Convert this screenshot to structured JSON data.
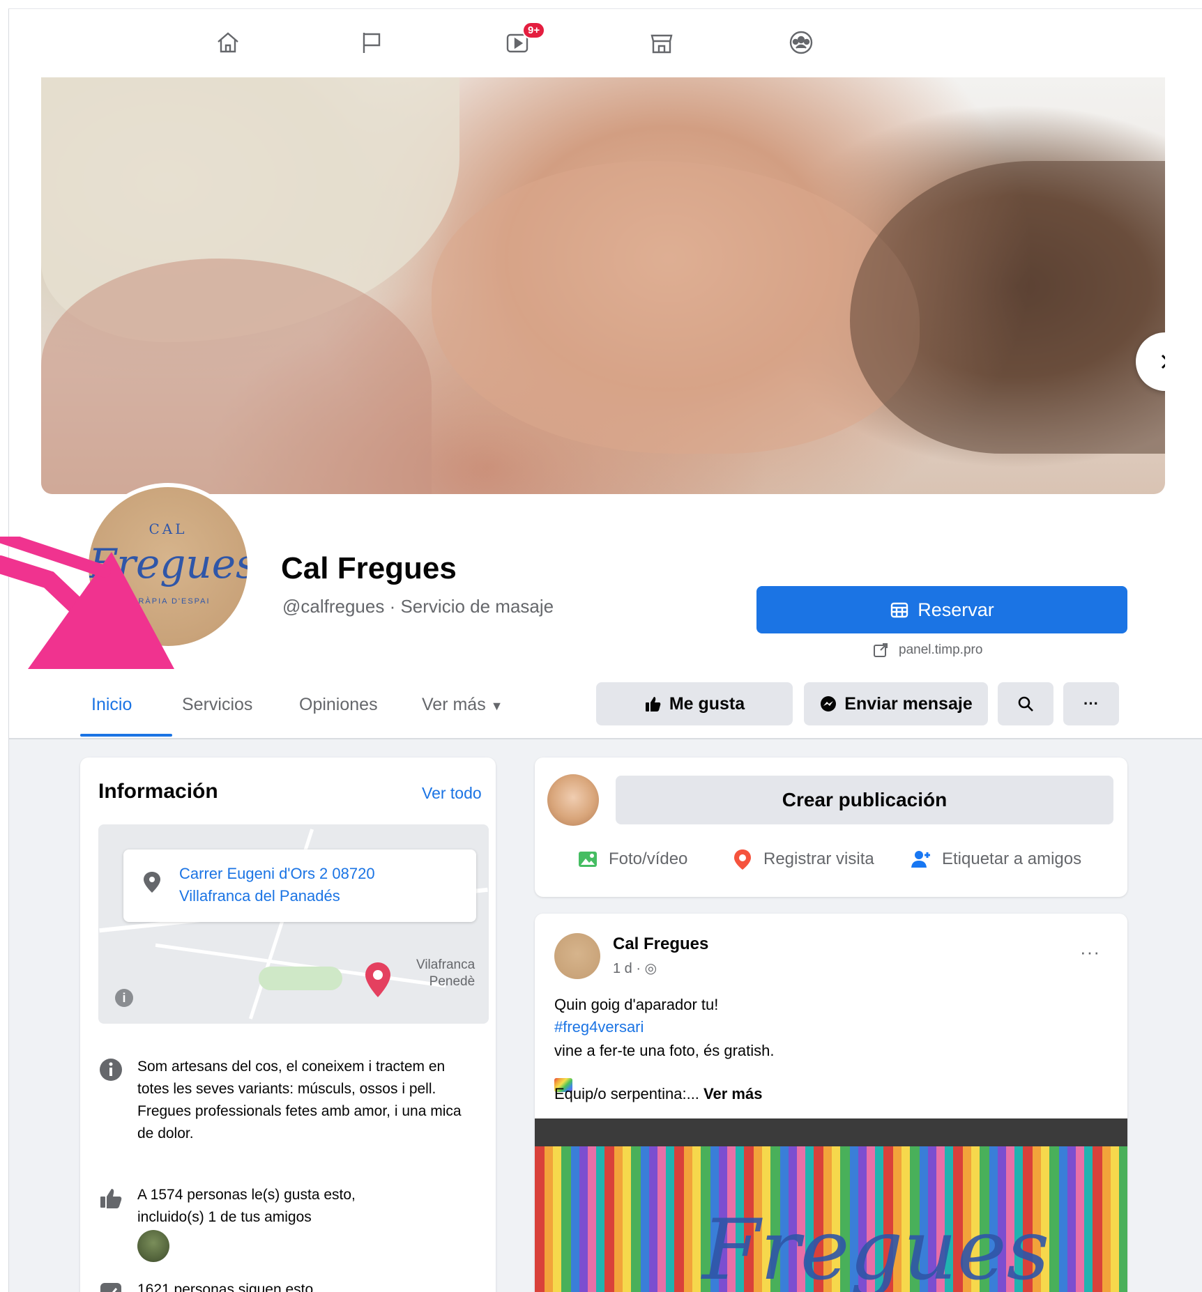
{
  "topnav": {
    "video_badge": "9+",
    "icons": [
      "home-icon",
      "flag-icon",
      "watch-icon",
      "marketplace-icon",
      "groups-icon"
    ]
  },
  "cover": {
    "next_icon": "chevron-right-icon"
  },
  "profile": {
    "logo_top": "CAL",
    "logo_main": "Fregues",
    "logo_sub": "TERÀPIA D'ESPAI",
    "name": "Cal Fregues",
    "handle": "@calfregues · Servicio de masaje"
  },
  "booking": {
    "button_label": "Reservar",
    "link_text": "panel.timp.pro"
  },
  "tabs": [
    {
      "label": "Inicio",
      "active": true
    },
    {
      "label": "Servicios",
      "active": false
    },
    {
      "label": "Opiniones",
      "active": false
    },
    {
      "label": "Ver más",
      "active": false
    }
  ],
  "actions": {
    "like": "Me gusta",
    "message": "Enviar mensaje",
    "search_icon": "search-icon",
    "more_icon": "more-icon"
  },
  "info": {
    "title": "Información",
    "see_all": "Ver todo",
    "address_line1": "Carrer Eugeni d'Ors 2 08720",
    "address_line2": "Villafranca del Panadés",
    "map_town_line1": "Vilafranca",
    "map_town_line2": "Penedè",
    "description": "Som artesans del cos, el coneixem i tractem en totes les seves variants: músculs, ossos i pell. Fregues professionals fetes amb amor, i una mica de dolor.",
    "likes_line1": "A 1574 personas le(s) gusta esto,",
    "likes_line2": "incluido(s) 1 de tus amigos",
    "followers": "1621 personas siguen esto"
  },
  "composer": {
    "placeholder": "Crear publicación",
    "photo_video": "Foto/vídeo",
    "check_in": "Registrar visita",
    "tag_friends": "Etiquetar a amigos"
  },
  "post": {
    "author": "Cal Fregues",
    "meta": "1 d · ",
    "line1": "Quin goig d'aparador tu!",
    "hashtag": "#freg4versari",
    "line2": "vine a fer-te una foto, és gratish.",
    "line3": "Equip/o serpentina:... ",
    "see_more": "Ver más",
    "more_dots": "···"
  },
  "colors": {
    "brand_blue": "#1b74e4",
    "annotation_pink": "#f0338f",
    "badge_red": "#e41e3f"
  }
}
